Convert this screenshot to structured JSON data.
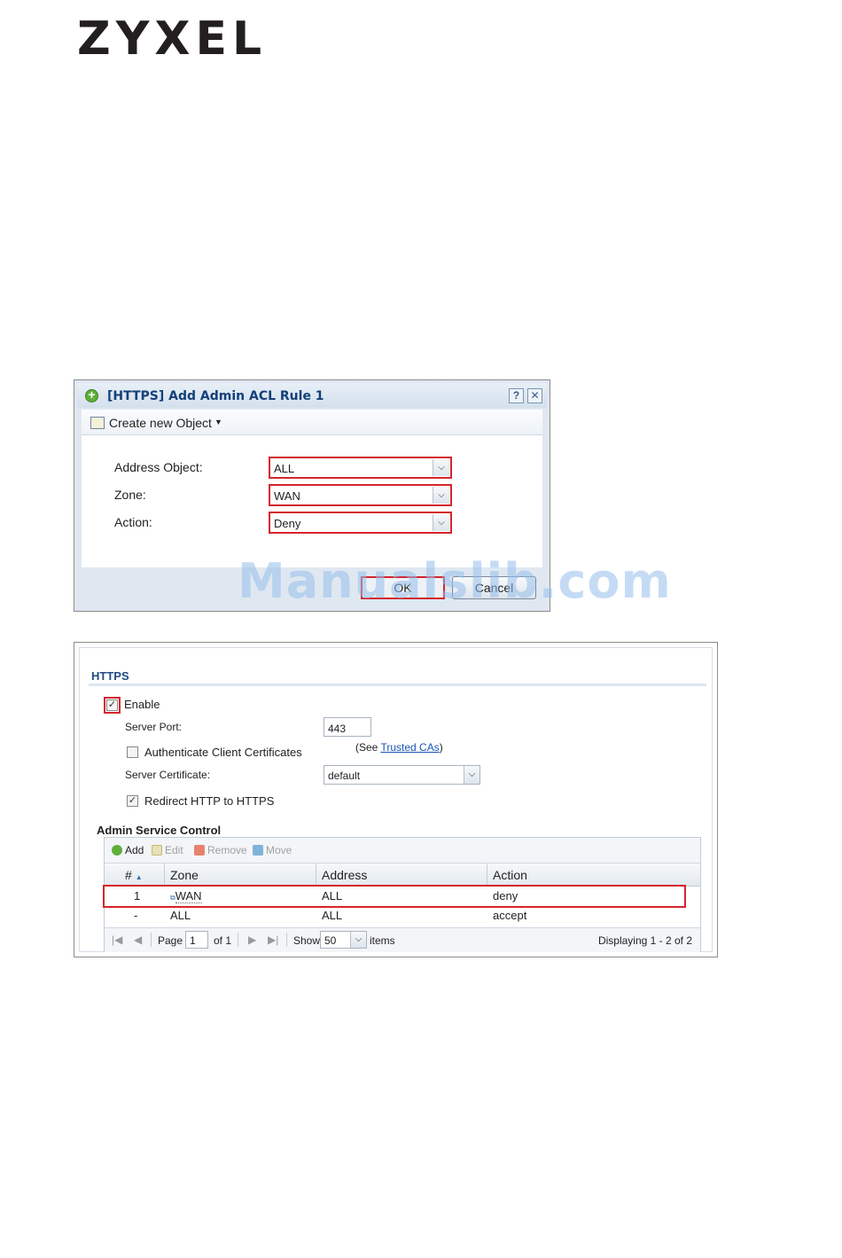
{
  "logo": "ZYXEL",
  "dialog": {
    "title": "[HTTPS] Add Admin ACL Rule 1",
    "help_label": "?",
    "close_label": "✕",
    "toolbar_create": "Create new Object",
    "fields": {
      "address_label": "Address Object:",
      "address_value": "ALL",
      "zone_label": "Zone:",
      "zone_value": "WAN",
      "action_label": "Action:",
      "action_value": "Deny"
    },
    "ok_label": "OK",
    "cancel_label": "Cancel"
  },
  "watermark": "Manualslib.com",
  "https": {
    "section_title": "HTTPS",
    "enable_label": "Enable",
    "enable_checked": true,
    "server_port_label": "Server Port:",
    "server_port_value": "443",
    "auth_client_label": "Authenticate Client Certificates",
    "auth_client_checked": false,
    "see_prefix": "(See ",
    "trusted_cas_link": "Trusted CAs",
    "see_suffix": ")",
    "server_cert_label": "Server Certificate:",
    "server_cert_value": "default",
    "redirect_label": "Redirect HTTP to HTTPS",
    "redirect_checked": true
  },
  "admin_service": {
    "title": "Admin Service Control",
    "toolbar": {
      "add": "Add",
      "edit": "Edit",
      "remove": "Remove",
      "move": "Move"
    },
    "columns": {
      "num": "#",
      "zone": "Zone",
      "address": "Address",
      "action": "Action"
    },
    "rows": [
      {
        "num": "1",
        "zone": "WAN",
        "address": "ALL",
        "action": "deny"
      },
      {
        "num": "-",
        "zone": "ALL",
        "address": "ALL",
        "action": "accept"
      }
    ],
    "pager": {
      "page_label": "Page",
      "page_value": "1",
      "of_label": "of 1",
      "show_label": "Show",
      "show_value": "50",
      "items_label": "items",
      "displaying": "Displaying 1 - 2 of 2"
    }
  },
  "colors": {
    "highlight": "#d4252c",
    "title_blue": "#14407a",
    "link": "#1a55b4"
  }
}
